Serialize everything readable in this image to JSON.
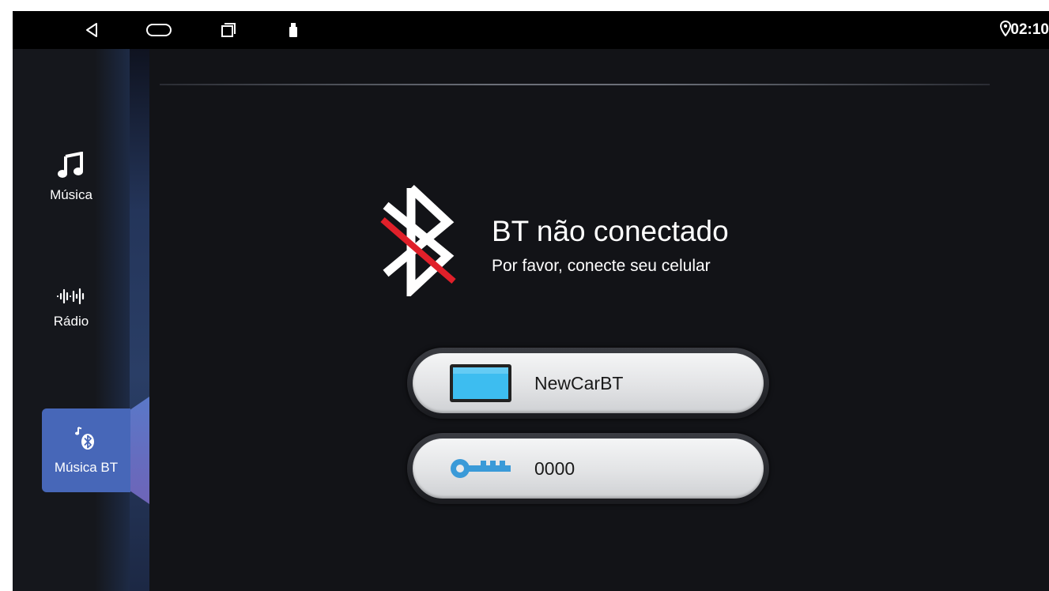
{
  "statusbar": {
    "icons": [
      "back-icon",
      "home-icon",
      "recents-icon",
      "usb-icon",
      "location-icon"
    ],
    "time": "02:10"
  },
  "sidebar": {
    "items": [
      {
        "label": "Música",
        "icon": "music-note-icon",
        "active": false
      },
      {
        "label": "Rádio",
        "icon": "radio-wave-icon",
        "active": false
      },
      {
        "label": "Música BT",
        "icon": "bluetooth-music-icon",
        "active": true
      }
    ]
  },
  "main": {
    "status_icon": "bluetooth-disconnected-icon",
    "status_title": "BT não conectado",
    "status_subtitle": "Por favor, conecte seu celular",
    "device_name": "NewCarBT",
    "device_icon": "screen-icon",
    "pin": "0000",
    "pin_icon": "key-icon"
  },
  "colors": {
    "background": "#121317",
    "active_tab": "#4767b8",
    "bt_cross": "#e0202a",
    "device_screen": "#3dbdf0",
    "key": "#3a9ad8"
  }
}
